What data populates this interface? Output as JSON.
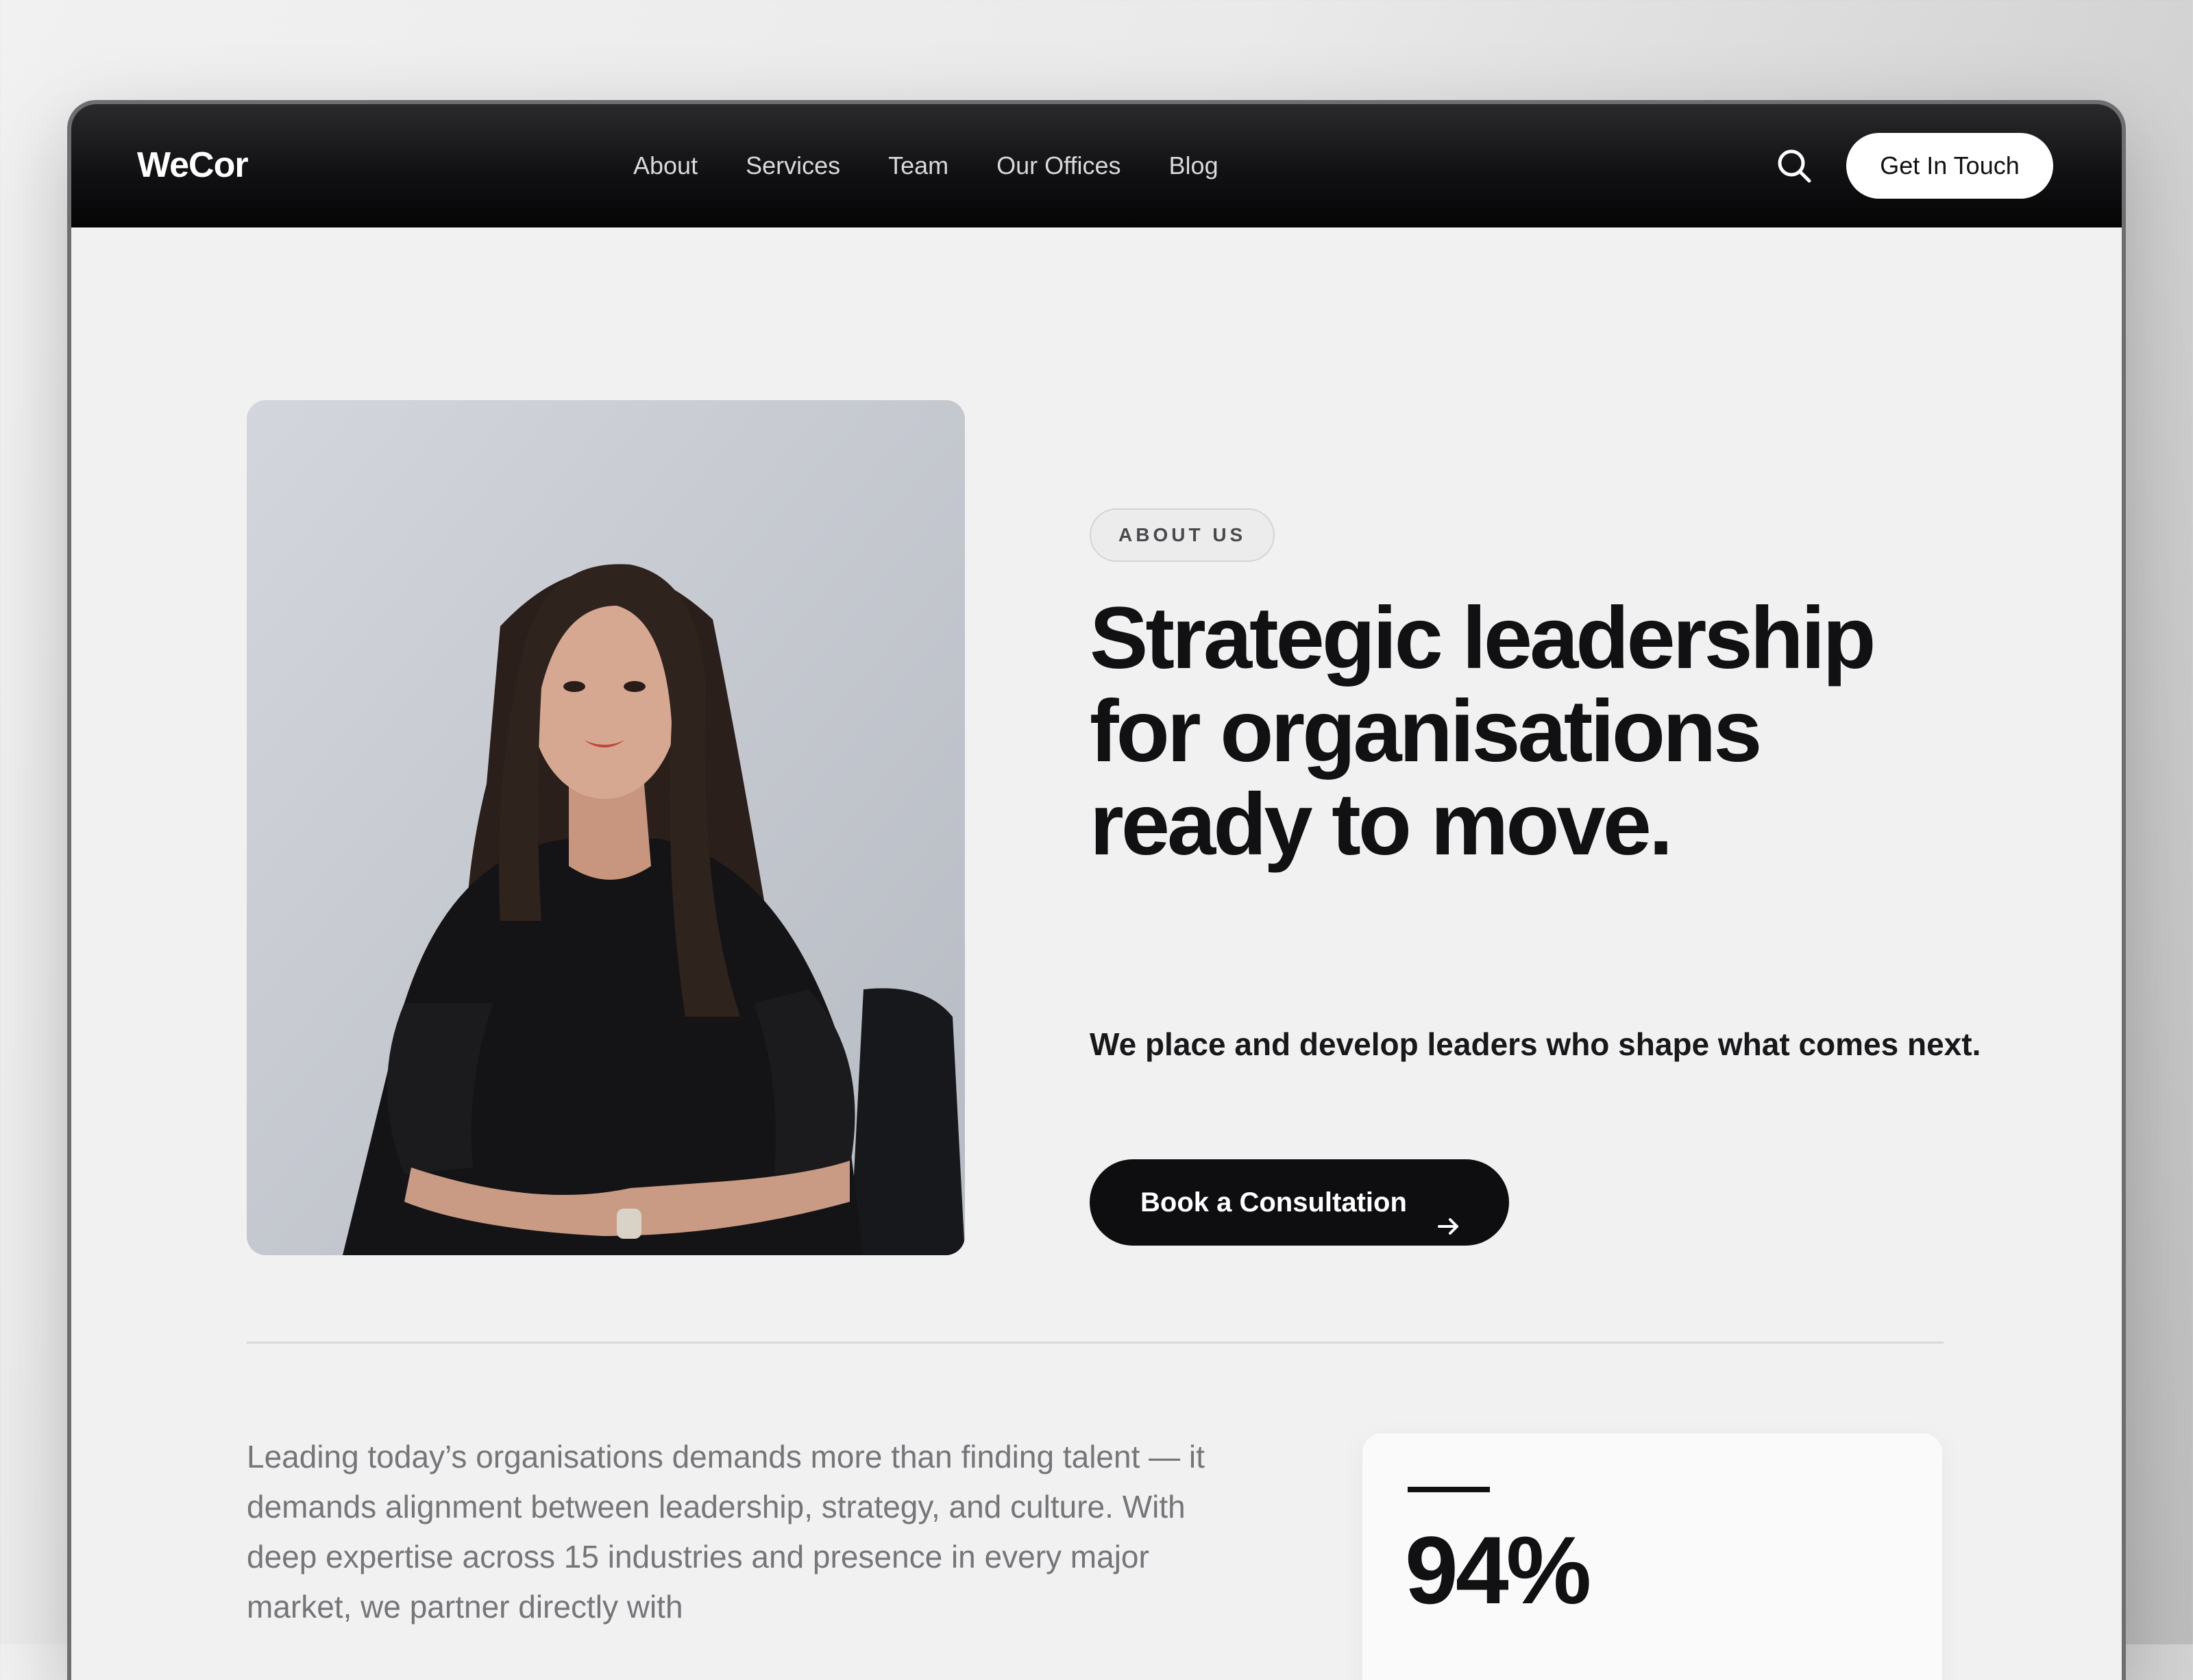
{
  "brand": {
    "name": "WeCor"
  },
  "nav": {
    "links": [
      {
        "label": "About"
      },
      {
        "label": "Services"
      },
      {
        "label": "Team"
      },
      {
        "label": "Our Offices"
      },
      {
        "label": "Blog"
      }
    ],
    "search_icon": "search-icon",
    "cta_label": "Get In Touch"
  },
  "hero": {
    "eyebrow": "ABOUT US",
    "headline_lines": [
      "Strategic leadership",
      "for organisations",
      "ready to move."
    ],
    "subhead": "We place and develop leaders who shape what comes next.",
    "button_label": "Book a Consultation",
    "button_icon": "arrow-right-icon",
    "photo": "portrait of a woman in a black blazer seated against a grey wall"
  },
  "about": {
    "body": "Leading today’s organisations demands more than finding talent — it demands alignment between leadership, strategy, and culture. With deep expertise across 15 industries and presence in every major market, we partner directly with"
  },
  "stat": {
    "value": "94%"
  },
  "colors": {
    "nav_bg": "#0e0e10",
    "page_bg": "#f1f1f1",
    "primary_button": "#0e0e10",
    "text": "#111114",
    "muted_text": "#75757a"
  }
}
